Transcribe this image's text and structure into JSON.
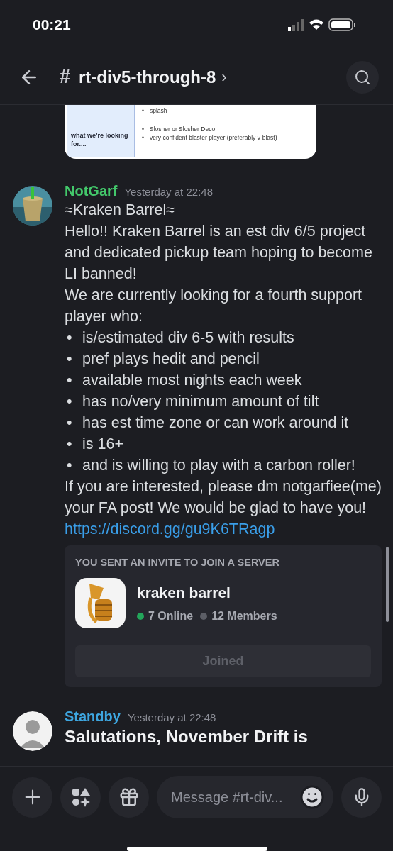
{
  "status_bar": {
    "time": "00:21"
  },
  "header": {
    "hash": "#",
    "channel": "rt-div5-through-8",
    "chevron": "›"
  },
  "embed_image": {
    "kind": "document",
    "bullet": "•",
    "rows": [
      {
        "label": "",
        "items": [
          "splash"
        ]
      },
      {
        "label": "what we’re looking for....",
        "items": [
          "Slosher or Slosher Deco",
          "very confident blaster player (preferably v-blast)"
        ]
      }
    ]
  },
  "messages": [
    {
      "author": "NotGarf",
      "color": "#43c86b",
      "timestamp": "Yesterday at 22:48",
      "bullet": "•",
      "paragraphs": [
        "≈Kraken Barrel≈",
        "Hello!! Kraken Barrel is an est div 6/5 project and dedicated pickup team hoping to become LI banned!",
        "We are currently looking for a fourth support player who:"
      ],
      "bullets": [
        "is/estimated div 6-5 with results",
        "pref plays hedit and pencil",
        "available most nights each week",
        "has no/very minimum amount of tilt",
        "has est time zone or can work around it",
        "is 16+",
        "and is willing to play with a carbon roller!"
      ],
      "closing": "If you are interested, please dm notgarfiee(me)  your FA post! We would be glad to have you!",
      "link": "https://discord.gg/gu9K6TRagp",
      "invite": {
        "heading": "YOU SENT AN INVITE TO JOIN A SERVER",
        "server": "kraken barrel",
        "online": "7 Online",
        "members": "12 Members",
        "button": "Joined",
        "disabled": true
      }
    },
    {
      "author": "Standby",
      "color": "#3ea6e0",
      "timestamp": "Yesterday at 22:48",
      "avatar": {
        "kind": "silhouette"
      },
      "paragraphs": [
        "Salutations, November Drift is"
      ]
    }
  ],
  "composer": {
    "placeholder": "Message #rt-div..."
  }
}
